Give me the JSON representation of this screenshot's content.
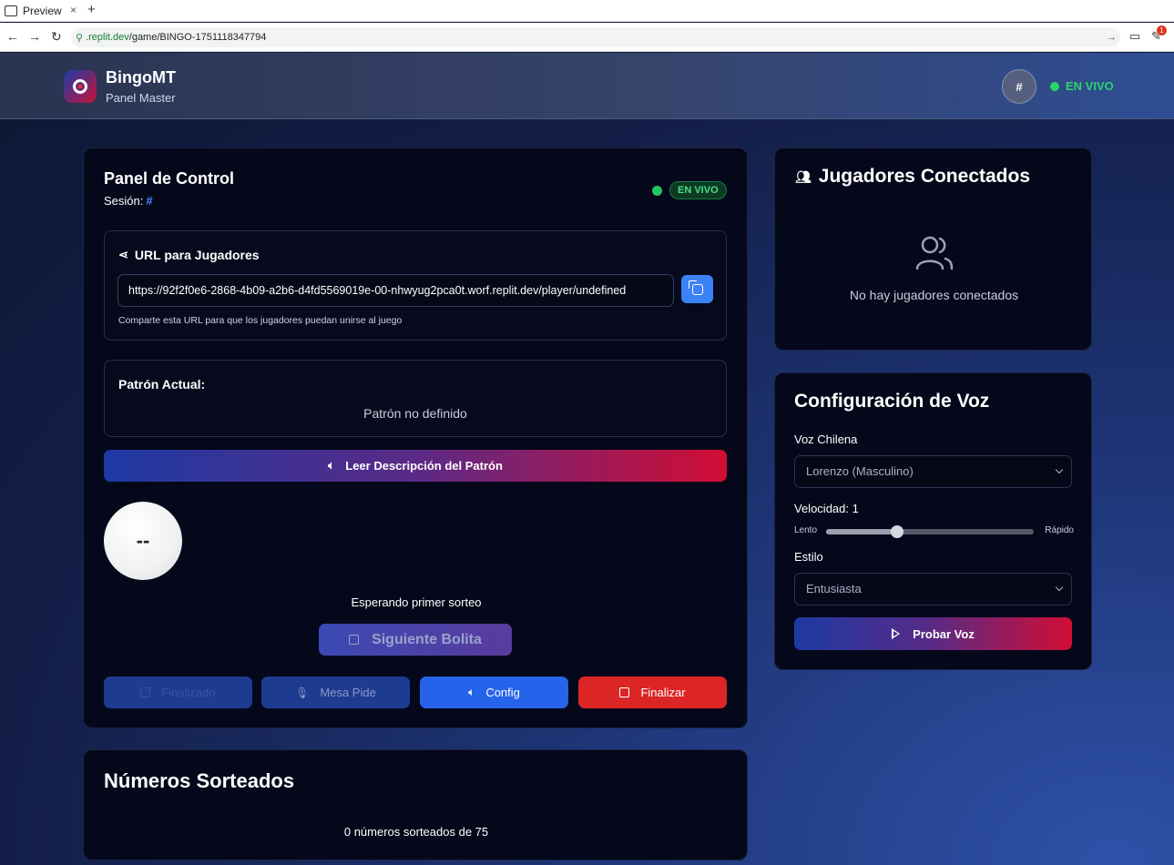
{
  "browser": {
    "tab_title": "Preview",
    "tab_close": "×",
    "new_tab": "+",
    "url_domain": ".replit.dev",
    "url_path": "/game/BINGO-1751118347794",
    "ext_badge": "1"
  },
  "header": {
    "brand": "BingoMT",
    "subtitle": "Panel Master",
    "hash_label": "#",
    "live_label": "EN VIVO"
  },
  "control": {
    "title": "Panel de Control",
    "session_label": "Sesión:",
    "session_value": "#",
    "live_pill": "EN VIVO",
    "url_section_title": "URL para Jugadores",
    "player_url": "https://92f2f0e6-2868-4b09-a2b6-d4fd5569019e-00-nhwyug2pca0t.worf.replit.dev/player/undefined",
    "url_help": "Comparte esta URL para que los jugadores puedan unirse al juego",
    "pattern_title": "Patrón Actual:",
    "pattern_value": "Patrón no definido",
    "read_pattern_button": "Leer Descripción del Patrón",
    "ball_value": "--",
    "waiting_text": "Esperando primer sorteo",
    "next_ball_button": "Siguiente Bolita",
    "finished_button": "Finalizado",
    "mesa_button": "Mesa Pide",
    "config_button": "Config",
    "finalizar_button": "Finalizar"
  },
  "drawn": {
    "title": "Números Sorteados",
    "count_text": "0 números sorteados de 75"
  },
  "players": {
    "title": "Jugadores Conectados",
    "empty_text": "No hay jugadores conectados"
  },
  "voice": {
    "title": "Configuración de Voz",
    "voice_label": "Voz Chilena",
    "voice_value": "Lorenzo (Masculino)",
    "speed_label": "Velocidad: 1",
    "speed_value": 1,
    "speed_fraction": 0.34,
    "slow_label": "Lento",
    "fast_label": "Rápido",
    "style_label": "Estilo",
    "style_value": "Entusiasta",
    "test_button": "Probar Voz"
  },
  "colors": {
    "accent_blue": "#3b82f6",
    "live_green": "#22c55e",
    "danger_red": "#dc2626"
  }
}
